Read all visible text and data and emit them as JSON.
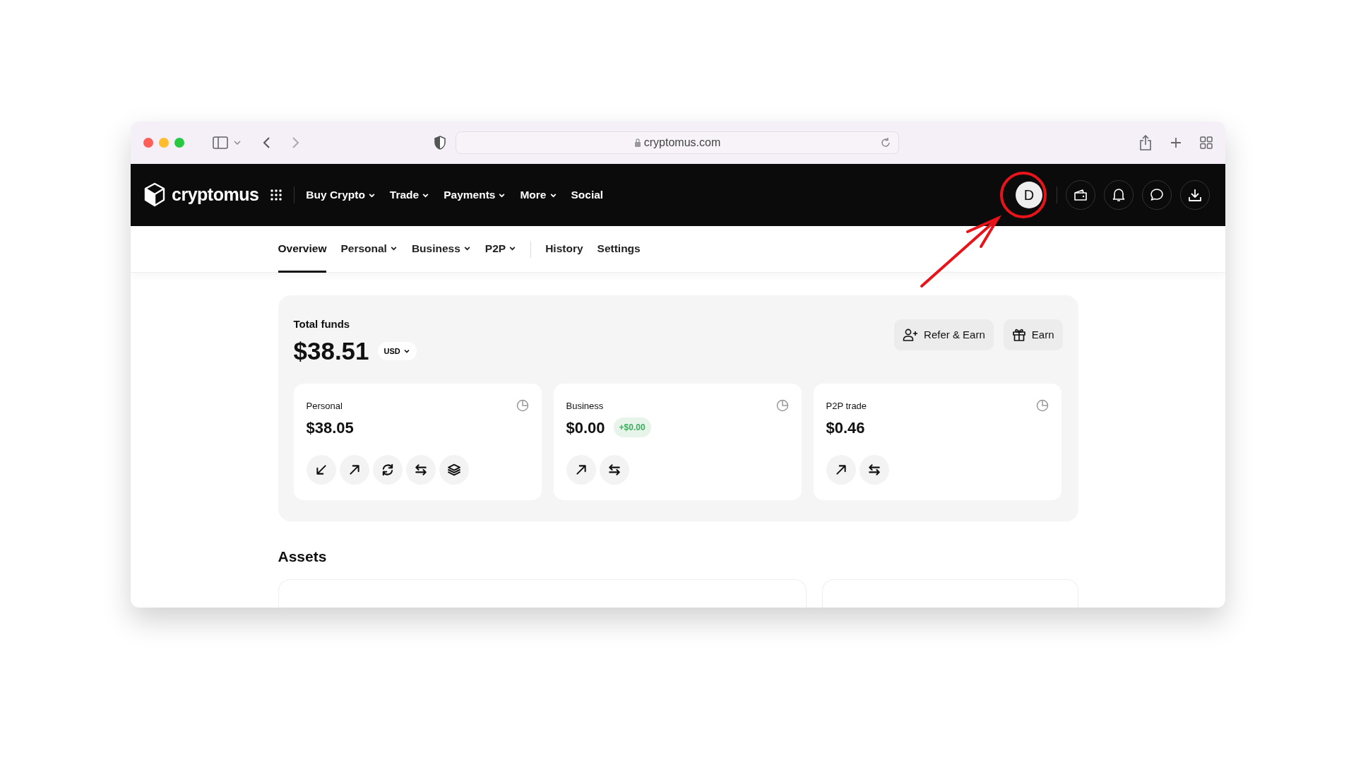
{
  "browser": {
    "url": "cryptomus.com"
  },
  "brand": {
    "name": "cryptomus"
  },
  "top_nav": [
    {
      "label": "Buy Crypto",
      "dropdown": true
    },
    {
      "label": "Trade",
      "dropdown": true
    },
    {
      "label": "Payments",
      "dropdown": true
    },
    {
      "label": "More",
      "dropdown": true
    },
    {
      "label": "Social",
      "dropdown": false
    }
  ],
  "avatar": {
    "initial": "D"
  },
  "sub_nav": [
    {
      "label": "Overview",
      "selected": true,
      "dropdown": false,
      "divider_before": false
    },
    {
      "label": "Personal",
      "selected": false,
      "dropdown": true,
      "divider_before": false
    },
    {
      "label": "Business",
      "selected": false,
      "dropdown": true,
      "divider_before": false
    },
    {
      "label": "P2P",
      "selected": false,
      "dropdown": true,
      "divider_before": false
    },
    {
      "label": "History",
      "selected": false,
      "dropdown": false,
      "divider_before": true
    },
    {
      "label": "Settings",
      "selected": false,
      "dropdown": false,
      "divider_before": false
    }
  ],
  "total": {
    "label": "Total funds",
    "amount": "$38.51",
    "currency": "USD"
  },
  "actions": [
    {
      "label": "Refer & Earn",
      "kind": "refer"
    },
    {
      "label": "Earn",
      "kind": "gift"
    }
  ],
  "wallets": [
    {
      "name": "Personal",
      "amount": "$38.05",
      "actions": [
        {
          "kind": "receive"
        },
        {
          "kind": "send"
        },
        {
          "kind": "convert"
        },
        {
          "kind": "transfer"
        },
        {
          "kind": "stake"
        }
      ]
    },
    {
      "name": "Business",
      "amount": "$0.00",
      "change": "+$0.00",
      "actions": [
        {
          "kind": "send"
        },
        {
          "kind": "transfer"
        }
      ]
    },
    {
      "name": "P2P trade",
      "amount": "$0.46",
      "actions": [
        {
          "kind": "send"
        },
        {
          "kind": "transfer"
        }
      ]
    }
  ],
  "assets": {
    "title": "Assets"
  }
}
